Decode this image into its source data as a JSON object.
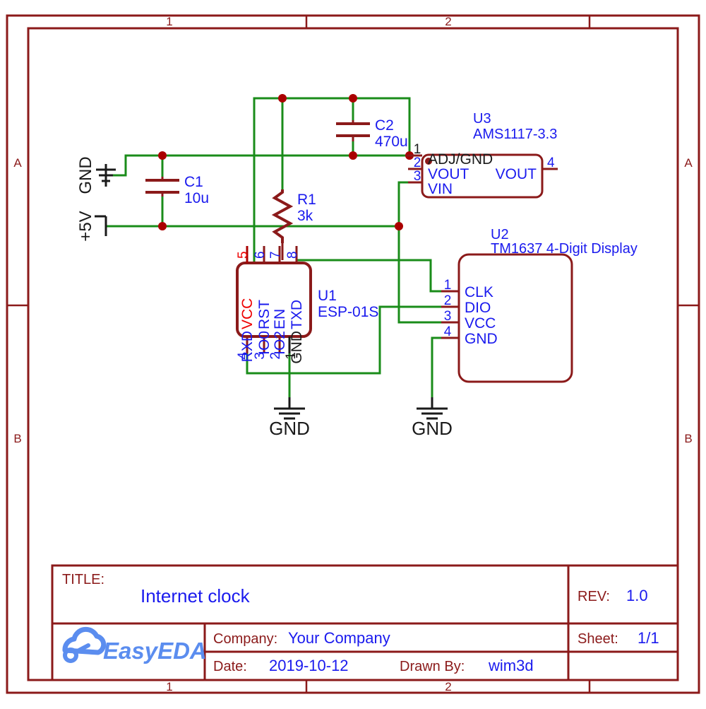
{
  "sheet": {
    "zone_columns": [
      "1",
      "2"
    ],
    "zone_rows": [
      "A",
      "B"
    ],
    "colors": {
      "frame": "#8b1a1a",
      "component": "#8b1a1a",
      "wire": "#1a8c1a",
      "pin_label": "#0000ee",
      "power_label": "#ee0000",
      "text_black": "#1a1a1a",
      "value_text": "#1a1aee",
      "logo": "#5b8def"
    }
  },
  "title_block": {
    "title_label": "TITLE:",
    "title_value": "Internet clock",
    "rev_label": "REV:",
    "rev_value": "1.0",
    "company_label": "Company:",
    "company_value": "Your Company",
    "sheet_label": "Sheet:",
    "sheet_value": "1/1",
    "date_label": "Date:",
    "date_value": "2019-10-12",
    "drawn_by_label": "Drawn By:",
    "drawn_by_value": "wim3d",
    "logo_text": "EasyEDA"
  },
  "components": {
    "u1": {
      "designator": "U1",
      "value": "ESP-01S",
      "pins_top": [
        {
          "number": "5",
          "name": "VCC",
          "highlight": true
        },
        {
          "number": "6",
          "name": "RST",
          "highlight": false
        },
        {
          "number": "7",
          "name": "EN",
          "highlight": false
        },
        {
          "number": "8",
          "name": "TXD",
          "highlight": false
        }
      ],
      "pins_bottom": [
        {
          "number": "4",
          "name": "RXD",
          "highlight": false
        },
        {
          "number": "3",
          "name": "IO0",
          "highlight": false
        },
        {
          "number": "2",
          "name": "IO2",
          "highlight": false
        },
        {
          "number": "1",
          "name": "GND",
          "highlight": false,
          "black": true
        }
      ]
    },
    "u2": {
      "designator": "U2",
      "value": "TM1637 4-Digit Display",
      "pins": [
        {
          "number": "1",
          "name": "CLK"
        },
        {
          "number": "2",
          "name": "DIO"
        },
        {
          "number": "3",
          "name": "VCC"
        },
        {
          "number": "4",
          "name": "GND"
        }
      ]
    },
    "u3": {
      "designator": "U3",
      "value": "AMS1117-3.3",
      "pins_left": [
        {
          "number": "1",
          "name": "ADJ/GND",
          "black": true
        },
        {
          "number": "2",
          "name": "VOUT"
        },
        {
          "number": "3",
          "name": "VIN"
        }
      ],
      "pins_right": [
        {
          "number": "4",
          "name": "VOUT"
        }
      ]
    },
    "c1": {
      "designator": "C1",
      "value": "10u"
    },
    "c2": {
      "designator": "C2",
      "value": "470u"
    },
    "r1": {
      "designator": "R1",
      "value": "3k"
    }
  },
  "net_labels": {
    "gnd_left": "GND",
    "plus5v": "+5V",
    "gnd_u1": "GND",
    "gnd_u2": "GND"
  }
}
